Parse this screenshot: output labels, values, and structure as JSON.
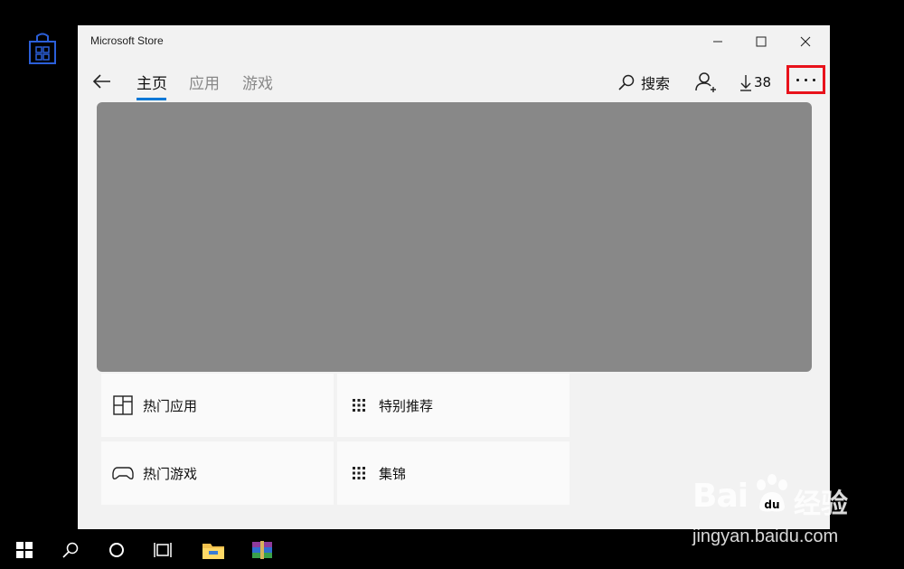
{
  "window": {
    "title": "Microsoft Store"
  },
  "nav": {
    "tabs": [
      {
        "label": "主页",
        "active": true
      },
      {
        "label": "应用",
        "active": false
      },
      {
        "label": "游戏",
        "active": false
      }
    ],
    "search_label": "搜索",
    "downloads_count": "38",
    "more_icon": "ellipsis-icon"
  },
  "tiles": [
    {
      "label": "热门应用",
      "icon": "layout-icon"
    },
    {
      "label": "特别推荐",
      "icon": "grid-icon"
    },
    {
      "label": "热门游戏",
      "icon": "gamepad-icon"
    },
    {
      "label": "集锦",
      "icon": "grid-icon"
    }
  ],
  "watermark": {
    "brand": "Bai",
    "brand_cn": "经验",
    "url": "jingyan.baidu.com"
  },
  "colors": {
    "accent": "#0078d7",
    "highlight": "#e8121b",
    "hero": "#888888"
  }
}
